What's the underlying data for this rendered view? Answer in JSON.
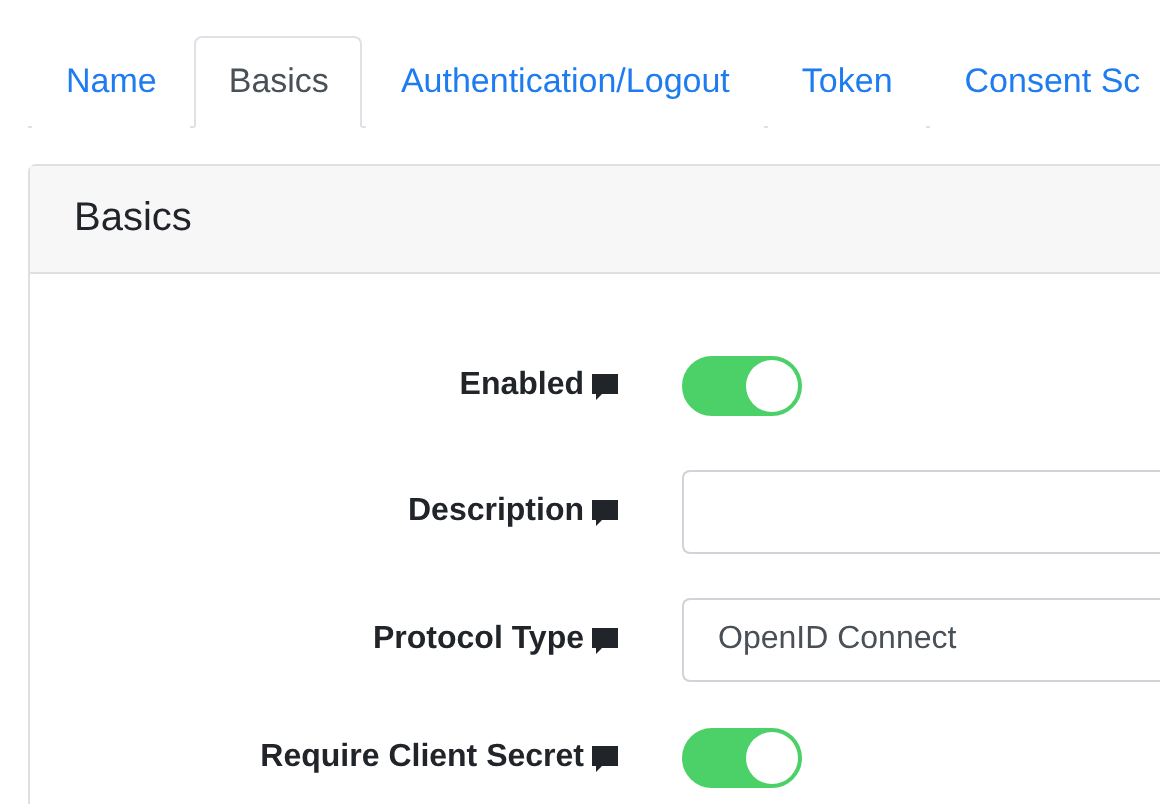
{
  "tabs": [
    {
      "label": "Name",
      "selected": false
    },
    {
      "label": "Basics",
      "selected": true
    },
    {
      "label": "Authentication/Logout",
      "selected": false
    },
    {
      "label": "Token",
      "selected": false
    },
    {
      "label": "Consent Sc",
      "selected": false
    }
  ],
  "card": {
    "title": "Basics",
    "fields": [
      {
        "kind": "toggle",
        "label": "Enabled",
        "on": true
      },
      {
        "kind": "input",
        "label": "Description"
      },
      {
        "kind": "select",
        "label": "Protocol Type",
        "value": "OpenID Connect"
      },
      {
        "kind": "toggle",
        "label": "Require Client Secret",
        "on": true
      }
    ]
  }
}
